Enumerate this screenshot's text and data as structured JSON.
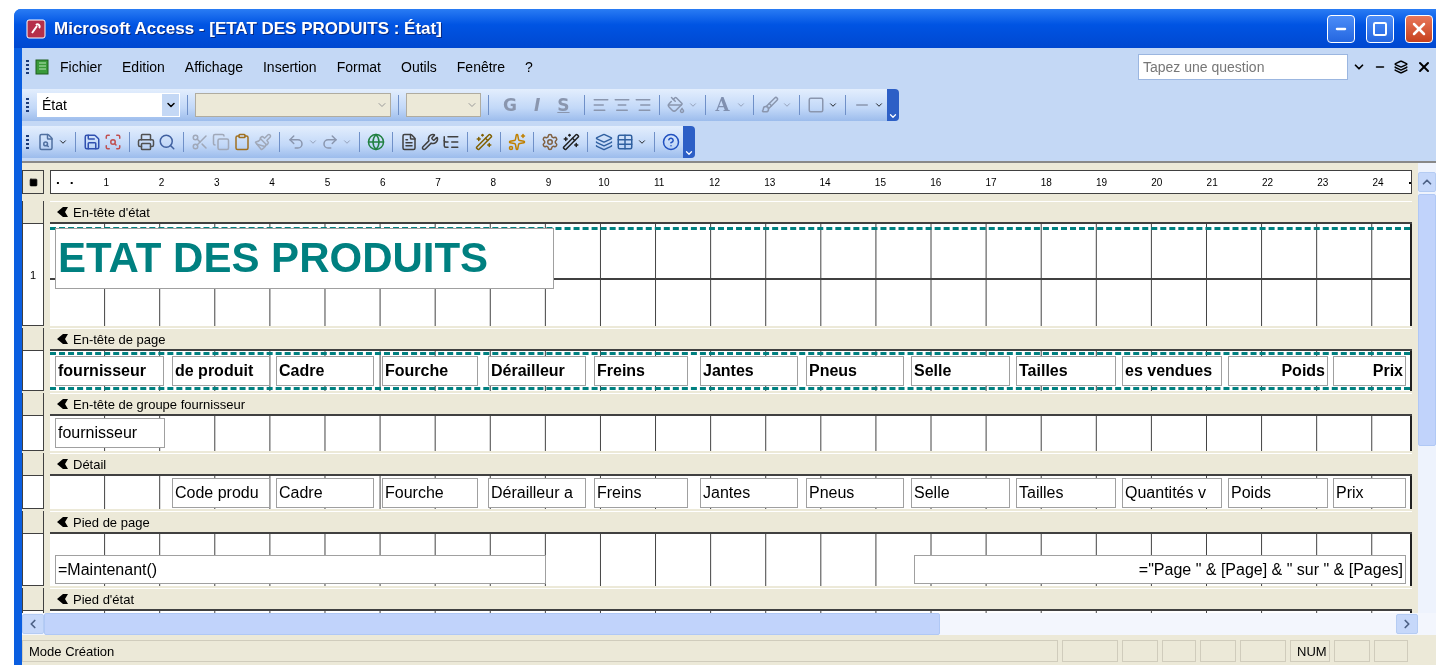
{
  "window": {
    "title": "Microsoft Access - [ETAT DES PRODUITS : État]"
  },
  "menu_bar": {
    "items": [
      "Fichier",
      "Edition",
      "Affichage",
      "Insertion",
      "Format",
      "Outils",
      "Fenêtre",
      "?"
    ],
    "help_search": {
      "placeholder": "Tapez une question"
    }
  },
  "formatting_toolbar": {
    "object_combo": {
      "value": "État"
    },
    "style_buttons": [
      "G",
      "I",
      "S"
    ],
    "font_color_button": "A"
  },
  "horizontal_ruler": [
    "1",
    "2",
    "3",
    "4",
    "5",
    "6",
    "7",
    "8",
    "9",
    "10",
    "11",
    "12",
    "13",
    "14",
    "15",
    "16",
    "17",
    "18",
    "19",
    "20",
    "21",
    "22",
    "23",
    "24"
  ],
  "vertical_ruler": [
    "1"
  ],
  "sections": [
    {
      "kind": "report_header",
      "title": "En-tête d'état",
      "controls": [
        {
          "kind": "title",
          "text": "ETAT DES PRODUITS"
        }
      ]
    },
    {
      "kind": "page_header",
      "title": "En-tête de page",
      "controls": [
        {
          "kind": "label",
          "text": "fournisseur"
        },
        {
          "kind": "label",
          "text": "de produit"
        },
        {
          "kind": "label",
          "text": "Cadre"
        },
        {
          "kind": "label",
          "text": "Fourche"
        },
        {
          "kind": "label",
          "text": "Dérailleur"
        },
        {
          "kind": "label",
          "text": "Freins"
        },
        {
          "kind": "label",
          "text": "Jantes"
        },
        {
          "kind": "label",
          "text": "Pneus"
        },
        {
          "kind": "label",
          "text": "Selle"
        },
        {
          "kind": "label",
          "text": "Tailles"
        },
        {
          "kind": "label",
          "text": "es vendues"
        },
        {
          "kind": "label",
          "text": "Poids"
        },
        {
          "kind": "label",
          "text": "Prix"
        }
      ]
    },
    {
      "kind": "group_header",
      "title": "En-tête de groupe fournisseur",
      "controls": [
        {
          "kind": "field",
          "text": "fournisseur"
        }
      ]
    },
    {
      "kind": "detail",
      "title": "Détail",
      "controls": [
        {
          "kind": "field",
          "text": "Code produ"
        },
        {
          "kind": "field",
          "text": "Cadre"
        },
        {
          "kind": "field",
          "text": "Fourche"
        },
        {
          "kind": "field",
          "text": "Dérailleur a"
        },
        {
          "kind": "field",
          "text": "Freins"
        },
        {
          "kind": "field",
          "text": "Jantes"
        },
        {
          "kind": "field",
          "text": "Pneus"
        },
        {
          "kind": "field",
          "text": "Selle"
        },
        {
          "kind": "field",
          "text": "Tailles"
        },
        {
          "kind": "field",
          "text": "Quantités v"
        },
        {
          "kind": "field",
          "text": "Poids"
        },
        {
          "kind": "field",
          "text": "Prix"
        }
      ]
    },
    {
      "kind": "page_footer",
      "title": "Pied de page",
      "controls": [
        {
          "kind": "field",
          "text": "=Maintenant()"
        },
        {
          "kind": "field",
          "text": "=\"Page \" & [Page] & \" sur \" & [Pages]"
        }
      ]
    },
    {
      "kind": "report_footer",
      "title": "Pied d'état"
    }
  ],
  "status_bar": {
    "mode": "Mode Création",
    "indicators": [
      "NUM"
    ]
  }
}
